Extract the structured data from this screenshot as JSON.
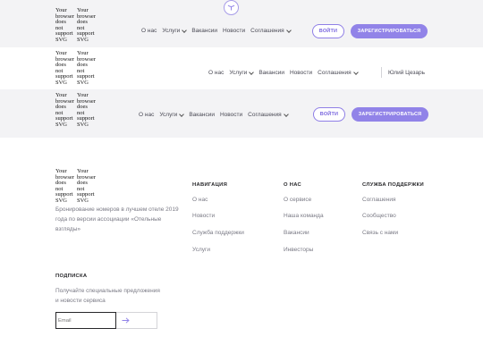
{
  "logo_alt": [
    "Your",
    "browser",
    "does",
    "not",
    "support",
    "SVG"
  ],
  "header": {
    "nav": [
      {
        "label": "О нас",
        "dropdown": false
      },
      {
        "label": "Услуги",
        "dropdown": true
      },
      {
        "label": "Вакансии",
        "dropdown": false
      },
      {
        "label": "Новости",
        "dropdown": false
      },
      {
        "label": "Соглашения",
        "dropdown": true
      }
    ],
    "login_label": "ВОЙТИ",
    "register_label": "ЗАРЕГИСТРИРОВАТЬСЯ",
    "username": "Юлий Цезарь"
  },
  "footer": {
    "description": "Бронирование номеров в лучшем отеле 2019 года по версии ассоциации «Отельные взгляды»",
    "columns": [
      {
        "title": "НАВИГАЦИЯ",
        "links": [
          "О нас",
          "Новости",
          "Служба поддержки",
          "Услуги"
        ]
      },
      {
        "title": "О НАС",
        "links": [
          "О сервисе",
          "Наша команда",
          "Вакансии",
          "Инвесторы"
        ]
      },
      {
        "title": "СЛУЖБА ПОДДЕРЖКИ",
        "links": [
          "Соглашения",
          "Сообщество",
          "Связь с нами"
        ]
      }
    ],
    "subscribe": {
      "title": "ПОДПИСКА",
      "text": "Получайте специальные предложения и новости сервиса",
      "email_placeholder": "Email"
    }
  },
  "colors": {
    "accent": "#9183e8",
    "band": "#f3f3f5"
  }
}
